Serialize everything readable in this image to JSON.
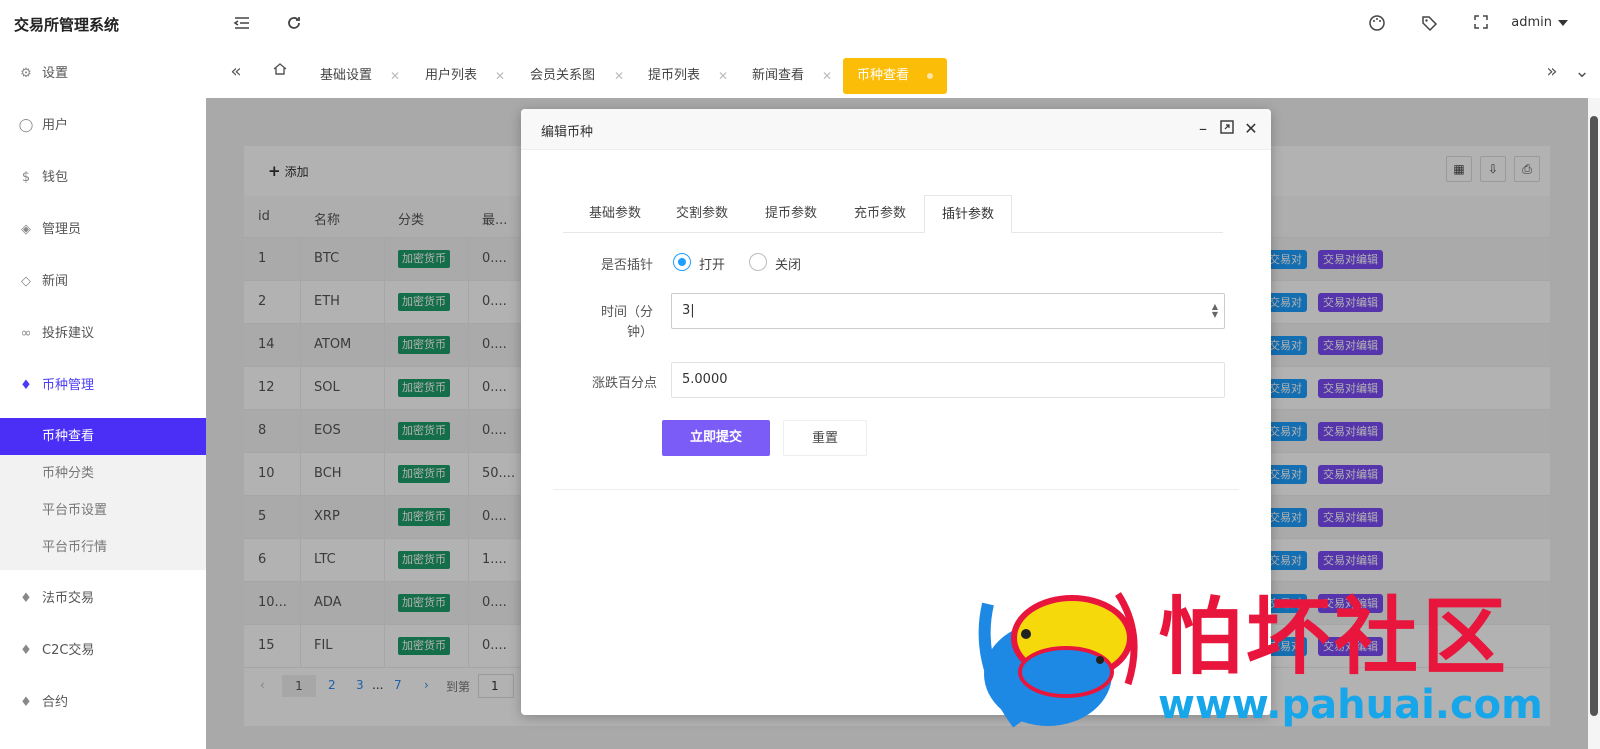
{
  "header": {
    "brand": "交易所管理系统",
    "user": "admin",
    "icons": [
      "menu-fold-icon",
      "refresh-icon",
      "theme-icon",
      "tag-icon",
      "fullscreen-icon"
    ]
  },
  "sidebar": {
    "items": [
      {
        "label": "设置",
        "icon": "gear-icon"
      },
      {
        "label": "用户",
        "icon": "user-icon"
      },
      {
        "label": "钱包",
        "icon": "dollar-icon"
      },
      {
        "label": "管理员",
        "icon": "shield-icon"
      },
      {
        "label": "新闻",
        "icon": "tag-icon"
      },
      {
        "label": "投拆建议",
        "icon": "link-icon"
      },
      {
        "label": "币种管理",
        "icon": "diamond-icon"
      }
    ],
    "sub_items": [
      "币种查看",
      "币种分类",
      "平台币设置",
      "平台币行情"
    ],
    "bottom_items": [
      {
        "label": "法币交易",
        "icon": "diamond-icon"
      },
      {
        "label": "C2C交易",
        "icon": "diamond-icon"
      },
      {
        "label": "合约",
        "icon": "diamond-icon"
      }
    ]
  },
  "tabs": [
    "基础设置",
    "用户列表",
    "会员关系图",
    "提币列表",
    "新闻查看",
    "币种查看"
  ],
  "toolbar": {
    "add_label": "添加"
  },
  "table": {
    "headers": [
      "id",
      "名称",
      "分类",
      "最..."
    ],
    "tag_label": "加密货币",
    "btn_pair": "交易对",
    "btn_pair_edit": "交易对编辑",
    "rows": [
      {
        "id": "1",
        "name": "BTC",
        "v": "0...."
      },
      {
        "id": "2",
        "name": "ETH",
        "v": "0...."
      },
      {
        "id": "14",
        "name": "ATOM",
        "v": "0...."
      },
      {
        "id": "12",
        "name": "SOL",
        "v": "0...."
      },
      {
        "id": "8",
        "name": "EOS",
        "v": "0...."
      },
      {
        "id": "10",
        "name": "BCH",
        "v": "50...."
      },
      {
        "id": "5",
        "name": "XRP",
        "v": "0...."
      },
      {
        "id": "6",
        "name": "LTC",
        "v": "1...."
      },
      {
        "id": "10...",
        "name": "ADA",
        "v": "0...."
      },
      {
        "id": "15",
        "name": "FIL",
        "v": "0...."
      }
    ]
  },
  "pager": {
    "pages": [
      "1",
      "2",
      "3",
      "...",
      "7"
    ],
    "goto": "到第",
    "input": "1"
  },
  "modal": {
    "title": "编辑币种",
    "tabs": [
      "基础参数",
      "交割参数",
      "提币参数",
      "充币参数",
      "插针参数"
    ],
    "active_tab": "插针参数",
    "fields": {
      "enable_label": "是否插针",
      "opt_on": "打开",
      "opt_off": "关闭",
      "time_label_1": "时间（分",
      "time_label_2": "钟）",
      "time_value": "3",
      "pct_label": "涨跌百分点",
      "pct_value": "5.0000"
    },
    "submit": "立即提交",
    "reset": "重置"
  },
  "watermark": {
    "title": "怕坏社区",
    "url": "www.pahuai.com"
  },
  "colors": {
    "primary": "#4b2ff7",
    "tab_active": "#fbbd08",
    "tag_green": "#1e9e6a",
    "btn_blue": "#1e9fff",
    "btn_purple": "#7b4cf7",
    "submit": "#7c5cf6"
  }
}
